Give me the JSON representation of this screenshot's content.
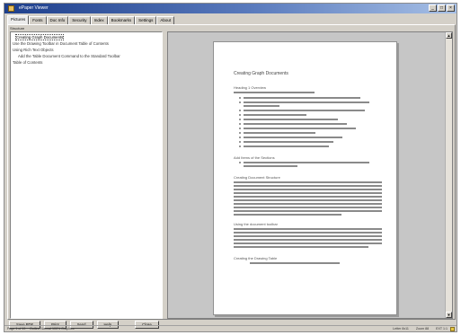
{
  "window": {
    "title": "ePaper Viewer",
    "controls": [
      "_",
      "□",
      "×"
    ]
  },
  "tabs": [
    "Pictures",
    "Fonts",
    "Doc Info",
    "Security",
    "Index",
    "Bookmarks",
    "Settings",
    "About"
  ],
  "structure_label": "Structure",
  "toc": [
    "Creating Graph Documents",
    "Use the Drawing Toolbar in Document Table of Contents",
    "Using Rich Text Objects",
    "Add the Table Document Command to the Standard Toolbar",
    "Table of Contents"
  ],
  "document": {
    "title": "Creating Graph Documents",
    "headings": [
      "Heading 1 Overview",
      "Add Items of the Sections",
      "Creating Document Structure",
      "Using the document toolbar",
      "Creating the Drawing Table"
    ]
  },
  "buttons": [
    "Save PDF",
    "Print",
    "Send",
    "Help",
    "Close"
  ],
  "status": {
    "page": "Page 1 of 19",
    "info": "Outline   Normal  100%  Graphics",
    "right_items": [
      "Letter 8x11",
      "Zoom 88",
      "EXT 1:1"
    ]
  }
}
